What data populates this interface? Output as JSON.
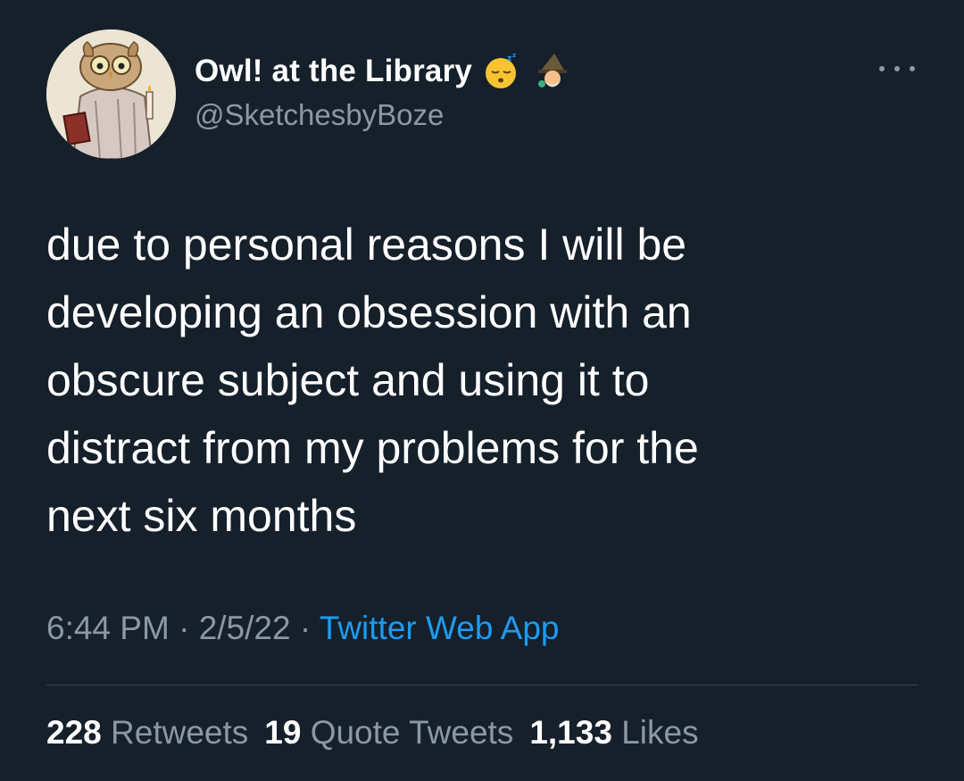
{
  "author": {
    "display_name": "Owl! at the Library",
    "handle": "@SketchesbyBoze",
    "avatar_icon": "owl-illustration-avatar",
    "name_emojis": [
      "sleeping-face-emoji",
      "mage-emoji"
    ]
  },
  "tweet": {
    "text_lines": [
      "due to personal reasons I will be",
      "developing an obsession with an",
      "obscure subject and using it to",
      "distract from my problems for the",
      "next six months"
    ]
  },
  "meta": {
    "time": "6:44 PM",
    "separator": "·",
    "date": "2/5/22",
    "source": "Twitter Web App"
  },
  "stats": {
    "retweets_count": "228",
    "retweets_label": "Retweets",
    "quotes_count": "19",
    "quotes_label": "Quote Tweets",
    "likes_count": "1,133",
    "likes_label": "Likes"
  },
  "colors": {
    "background": "#15202b",
    "text_primary": "#ffffff",
    "text_secondary": "#8b98a5",
    "link": "#1d9bf0",
    "divider": "#38444d"
  }
}
